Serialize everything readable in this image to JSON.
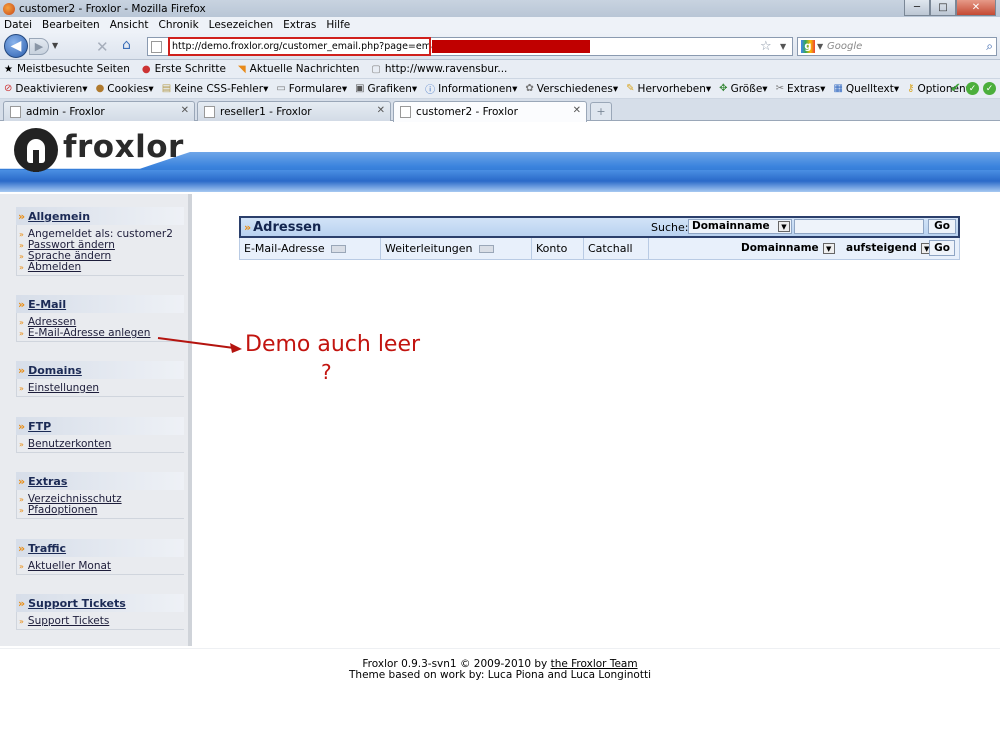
{
  "window": {
    "title": "customer2 - Froxlor - Mozilla Firefox",
    "controls": {
      "minimize": "─",
      "maximize": "□",
      "close": "✕"
    }
  },
  "menu": [
    "Datei",
    "Bearbeiten",
    "Ansicht",
    "Chronik",
    "Lesezeichen",
    "Extras",
    "Hilfe"
  ],
  "nav": {
    "url": "http://demo.froxlor.org/customer_email.php?page=emails&s=",
    "search_placeholder": "Google"
  },
  "bookmarks": [
    "Meistbesuchte Seiten",
    "Erste Schritte",
    "Aktuelle Nachrichten",
    "http://www.ravensbur..."
  ],
  "devbar": [
    "Deaktivieren",
    "Cookies",
    "Keine CSS-Fehler",
    "Formulare",
    "Grafiken",
    "Informationen",
    "Verschiedenes",
    "Hervorheben",
    "Größe",
    "Extras",
    "Quelltext",
    "Optionen"
  ],
  "tabs": [
    "admin - Froxlor",
    "reseller1 - Froxlor",
    "customer2 - Froxlor"
  ],
  "logo_text": "froxlor",
  "sidebar": {
    "sections": [
      {
        "title": "Allgemein",
        "static": "Angemeldet als: customer2",
        "items": [
          "Passwort ändern",
          "Sprache ändern",
          "Abmelden"
        ]
      },
      {
        "title": "E-Mail",
        "items": [
          "Adressen",
          "E-Mail-Adresse anlegen"
        ]
      },
      {
        "title": "Domains",
        "items": [
          "Einstellungen"
        ]
      },
      {
        "title": "FTP",
        "items": [
          "Benutzerkonten"
        ]
      },
      {
        "title": "Extras",
        "items": [
          "Verzeichnisschutz",
          "Pfadoptionen"
        ]
      },
      {
        "title": "Traffic",
        "items": [
          "Aktueller Monat"
        ]
      },
      {
        "title": "Support Tickets",
        "items": [
          "Support Tickets"
        ]
      }
    ]
  },
  "table": {
    "title": "Adressen",
    "search_label": "Suche:",
    "search_field": "Domainname",
    "go": "Go",
    "columns": [
      "E-Mail-Adresse",
      "Weiterleitungen",
      "Konto",
      "Catchall"
    ],
    "order_by": "Domainname",
    "order_dir": "aufsteigend"
  },
  "annotation": {
    "text": "Demo auch leer",
    "question": "?"
  },
  "footer": {
    "line1_prefix": "Froxlor 0.9.3-svn1 © 2009-2010 by ",
    "line1_link": "the Froxlor Team",
    "line2": "Theme based on work by: Luca Piona and Luca Longinotti"
  }
}
